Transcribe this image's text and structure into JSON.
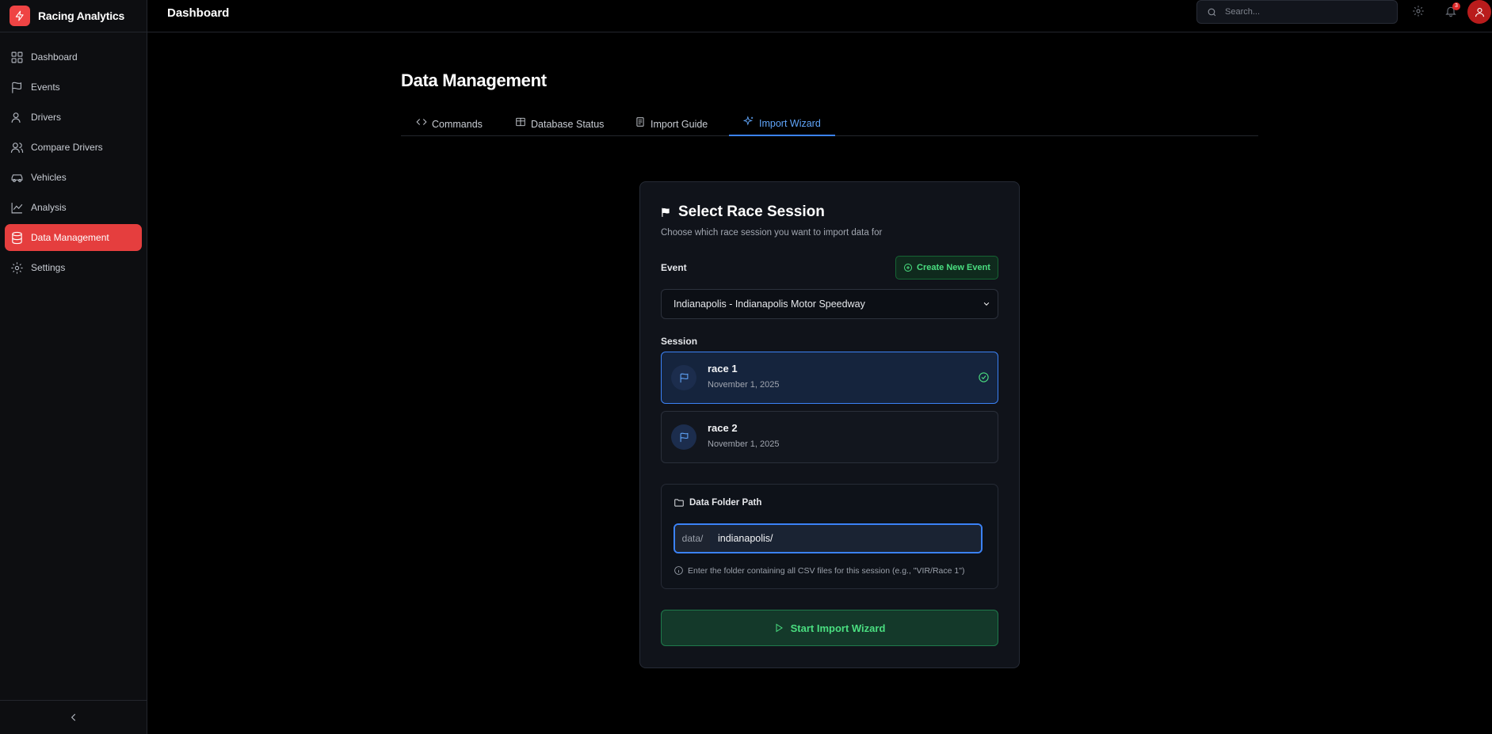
{
  "brand": {
    "name": "Racing Analytics",
    "logo_icon": "lightning-icon",
    "accent": "#ef4444"
  },
  "sidebar": {
    "items": [
      {
        "label": "Dashboard",
        "icon": "grid-icon",
        "active": false
      },
      {
        "label": "Events",
        "icon": "flag-icon",
        "active": false
      },
      {
        "label": "Drivers",
        "icon": "user-icon",
        "active": false
      },
      {
        "label": "Compare Drivers",
        "icon": "users-icon",
        "active": false
      },
      {
        "label": "Vehicles",
        "icon": "car-icon",
        "active": false
      },
      {
        "label": "Analysis",
        "icon": "chart-line-icon",
        "active": false
      },
      {
        "label": "Data Management",
        "icon": "database-icon",
        "active": true
      },
      {
        "label": "Settings",
        "icon": "gear-icon",
        "active": false
      }
    ],
    "collapse_icon": "chevron-left-icon"
  },
  "topbar": {
    "title": "Dashboard",
    "search_placeholder": "Search...",
    "notification_count": "3"
  },
  "main": {
    "title": "Data Management",
    "tabs": [
      {
        "label": "Commands",
        "icon": "code-icon",
        "active": false
      },
      {
        "label": "Database Status",
        "icon": "table-icon",
        "active": false
      },
      {
        "label": "Import Guide",
        "icon": "book-icon",
        "active": false
      },
      {
        "label": "Import Wizard",
        "icon": "sparkles-icon",
        "active": true
      }
    ]
  },
  "wizard": {
    "title": "Select Race Session",
    "subtitle": "Choose which race session you want to import data for",
    "event_label": "Event",
    "create_event_label": "Create New Event",
    "event_selected": "Indianapolis - Indianapolis Motor Speedway",
    "session_label": "Session",
    "sessions": [
      {
        "name": "race 1",
        "date": "November 1, 2025",
        "selected": true
      },
      {
        "name": "race 2",
        "date": "November 1, 2025",
        "selected": false
      }
    ],
    "folder_label": "Data Folder Path",
    "folder_prefix": "data/",
    "folder_value": "indianapolis/",
    "folder_hint": "Enter the folder containing all CSV files for this session (e.g., \"VIR/Race 1\")",
    "start_label": "Start Import Wizard"
  },
  "colors": {
    "active_nav": "#e53e3e",
    "tab_active": "#60a5fa",
    "success": "#4ade80",
    "selected_border": "#3b82f6"
  }
}
